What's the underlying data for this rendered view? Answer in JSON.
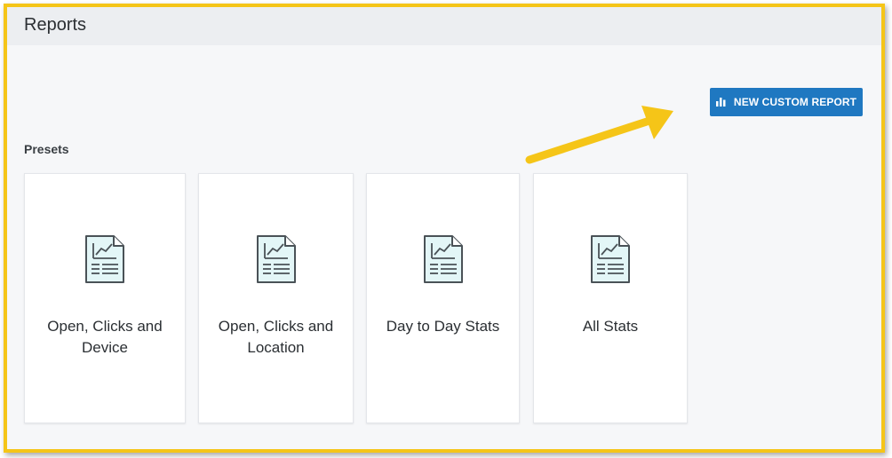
{
  "header": {
    "title": "Reports"
  },
  "toolbar": {
    "new_report_label": "NEW CUSTOM REPORT"
  },
  "presets": {
    "label": "Presets",
    "cards": [
      {
        "label": "Open, Clicks and Device"
      },
      {
        "label": "Open, Clicks and Location"
      },
      {
        "label": "Day to Day Stats"
      },
      {
        "label": "All Stats"
      }
    ]
  },
  "colors": {
    "accent": "#1f78c1",
    "highlight": "#f5c518",
    "icon_fill": "#e3f6f7",
    "icon_stroke": "#4a5257"
  },
  "icons": {
    "report": "report-document-icon",
    "button": "bar-chart-icon"
  }
}
